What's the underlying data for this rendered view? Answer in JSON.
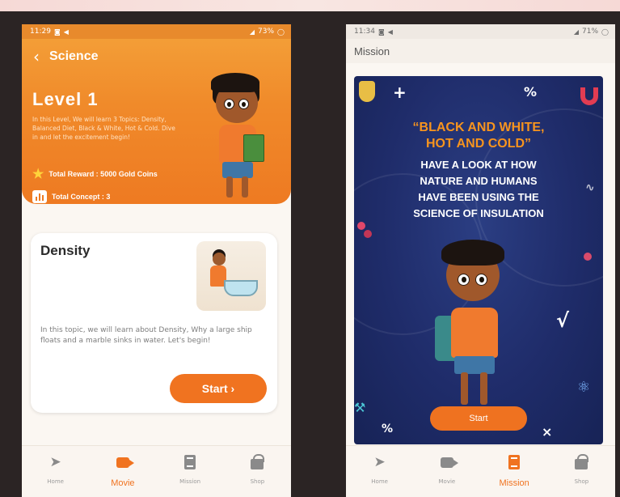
{
  "left": {
    "status": {
      "time": "11:29",
      "battery": "73%"
    },
    "nav_title": "Science",
    "level_title": "Level  1",
    "level_desc": "In this Level, We will learn 3 Topics: Density, Balanced Diet, Black & White, Hot & Cold. Dive in and let the excitement begin!",
    "reward": "Total Reward : 5000 Gold Coins",
    "concepts": "Total Concept : 3",
    "topic": {
      "title": "Density",
      "desc": "In this topic, we will learn about Density, Why a large ship floats and a marble sinks in water. Let's begin!",
      "start_label": "Start ›"
    },
    "bottom_nav": [
      {
        "label": "Home",
        "icon": "send-icon"
      },
      {
        "label": "Movie",
        "icon": "video-icon",
        "active": true
      },
      {
        "label": "Mission",
        "icon": "document-icon"
      },
      {
        "label": "Shop",
        "icon": "lock-icon"
      }
    ]
  },
  "right": {
    "status": {
      "time": "11:34",
      "battery": "71%"
    },
    "header_title": "Mission",
    "headline": [
      "“BLACK AND WHITE,",
      "HOT AND COLD”"
    ],
    "sub": [
      "HAVE A LOOK AT HOW",
      "NATURE  AND HUMANS",
      "HAVE BEEN USING THE",
      "SCIENCE OF INSULATION"
    ],
    "start_label": "Start",
    "bottom_nav": [
      {
        "label": "Home",
        "icon": "send-icon"
      },
      {
        "label": "Movie",
        "icon": "video-icon"
      },
      {
        "label": "Mission",
        "icon": "document-icon",
        "active": true
      },
      {
        "label": "Shop",
        "icon": "lock-icon"
      }
    ]
  },
  "colors": {
    "accent": "#f07320",
    "poster_bg": "#1f2c6a",
    "headline": "#f7941e"
  }
}
